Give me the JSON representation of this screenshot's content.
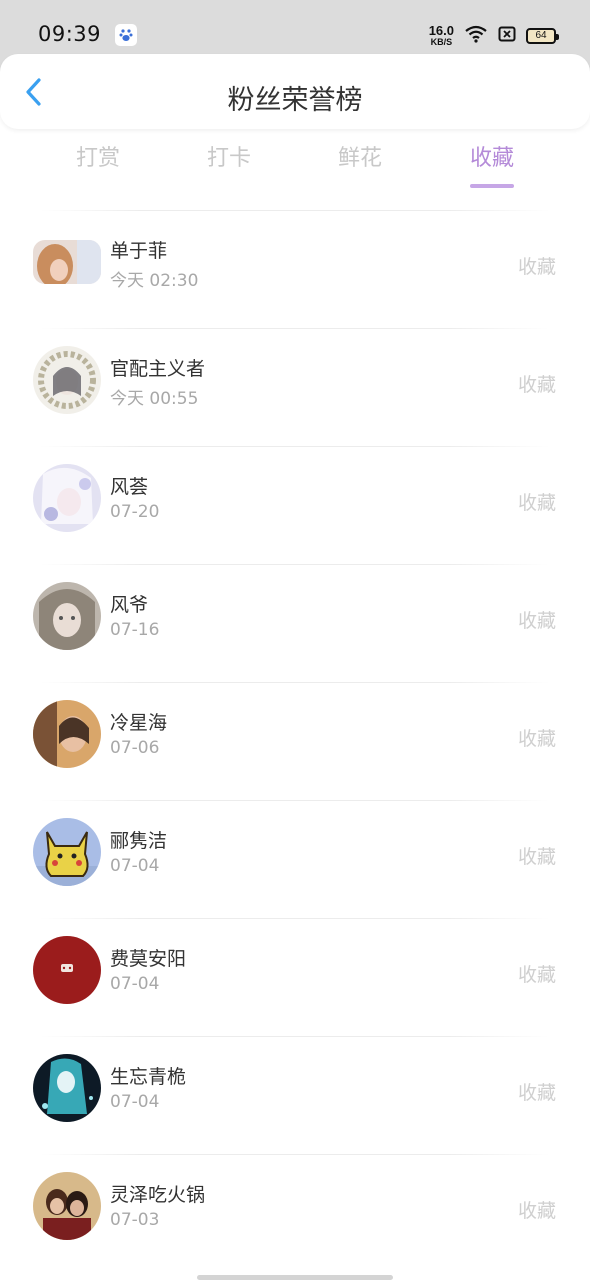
{
  "status_bar": {
    "time": "09:39",
    "net_speed": "16.0",
    "net_unit": "KB/S",
    "battery": "64"
  },
  "header": {
    "title": "粉丝荣誉榜"
  },
  "tabs": [
    {
      "label": "打赏",
      "active": false
    },
    {
      "label": "打卡",
      "active": false
    },
    {
      "label": "鲜花",
      "active": false
    },
    {
      "label": "收藏",
      "active": true
    }
  ],
  "colors": {
    "accent": "#b48ad8",
    "tab_inactive": "#c8c8c8",
    "status_bar_bg": "#dcdcdc"
  },
  "list": [
    {
      "name": "单于菲",
      "time": "今天 02:30",
      "action": "收藏",
      "avatar_icon": "avatar-girl-light-hair"
    },
    {
      "name": "官配主义者",
      "time": "今天 00:55",
      "action": "收藏",
      "avatar_icon": "avatar-anime-floral"
    },
    {
      "name": "风荟",
      "time": "07-20",
      "action": "收藏",
      "avatar_icon": "avatar-anime-white"
    },
    {
      "name": "风爷",
      "time": "07-16",
      "action": "收藏",
      "avatar_icon": "avatar-anime-gray"
    },
    {
      "name": "冷星海",
      "time": "07-06",
      "action": "收藏",
      "avatar_icon": "avatar-photo-warm"
    },
    {
      "name": "郦隽洁",
      "time": "07-04",
      "action": "收藏",
      "avatar_icon": "avatar-pikachu"
    },
    {
      "name": "费莫安阳",
      "time": "07-04",
      "action": "收藏",
      "avatar_icon": "avatar-red"
    },
    {
      "name": "生忘青桅",
      "time": "07-04",
      "action": "收藏",
      "avatar_icon": "avatar-anime-cyan"
    },
    {
      "name": "灵泽吃火锅",
      "time": "07-03",
      "action": "收藏",
      "avatar_icon": "avatar-photo-couple"
    }
  ]
}
